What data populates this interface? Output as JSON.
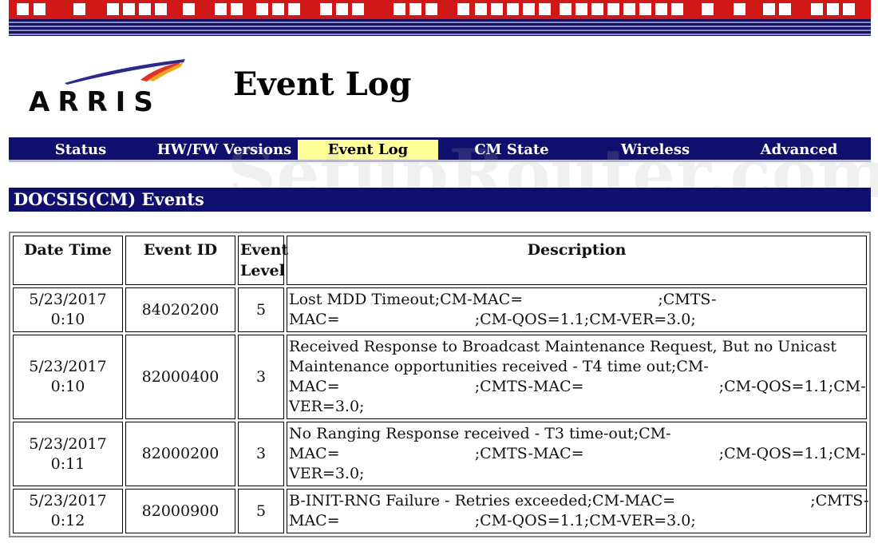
{
  "brand": {
    "logo_text": "ARRIS",
    "colors": {
      "banner_red": "#d01818",
      "navy": "#0f0f6e",
      "active_tab": "#ffff99"
    }
  },
  "page_title": "Event Log",
  "nav": [
    {
      "label": "Status"
    },
    {
      "label": "HW/FW Versions"
    },
    {
      "label": "Event Log",
      "active": true
    },
    {
      "label": "CM State"
    },
    {
      "label": "Wireless"
    },
    {
      "label": "Advanced"
    }
  ],
  "watermark": "SetupRouter.com",
  "section_title": "DOCSIS(CM) Events",
  "table": {
    "headers": [
      "Date Time",
      "Event ID",
      "Event Level",
      "Description"
    ],
    "rows": [
      {
        "date": "5/23/2017",
        "time": "0:10",
        "event_id": "84020200",
        "level": "5",
        "desc": [
          "Lost MDD Timeout;CM-MAC=                            ;CMTS-",
          "MAC=                            ;CM-QOS=1.1;CM-VER=3.0;"
        ]
      },
      {
        "date": "5/23/2017",
        "time": "0:10",
        "event_id": "82000400",
        "level": "3",
        "desc": [
          "Received Response to Broadcast Maintenance Request, But no Unicast",
          "Maintenance opportunities received - T4 time out;CM-",
          "MAC=                            ;CMTS-MAC=                            ;CM-QOS=1.1;CM-",
          "VER=3.0;"
        ]
      },
      {
        "date": "5/23/2017",
        "time": "0:11",
        "event_id": "82000200",
        "level": "3",
        "desc": [
          "No Ranging Response received - T3 time-out;CM-",
          "MAC=                            ;CMTS-MAC=                            ;CM-QOS=1.1;CM-",
          "VER=3.0;"
        ]
      },
      {
        "date": "5/23/2017",
        "time": "0:12",
        "event_id": "82000900",
        "level": "5",
        "desc": [
          "B-INIT-RNG Failure - Retries exceeded;CM-MAC=                            ;CMTS-",
          "MAC=                            ;CM-QOS=1.1;CM-VER=3.0;"
        ]
      }
    ]
  }
}
